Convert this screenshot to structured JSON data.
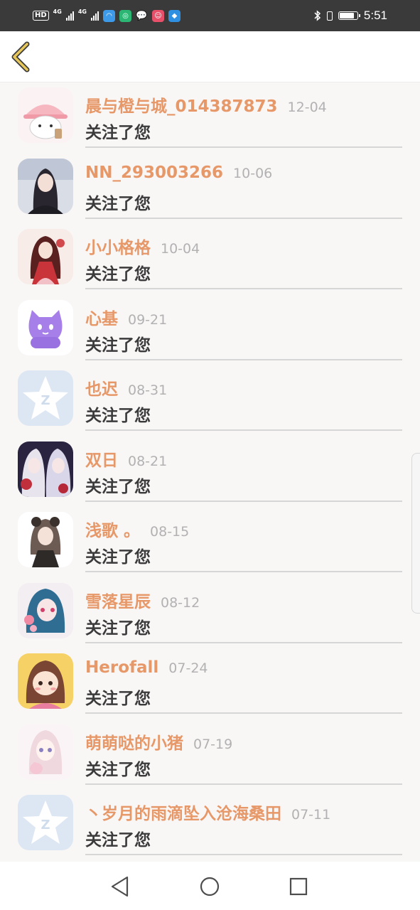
{
  "status_bar": {
    "hd": "HD",
    "network1": "4G",
    "network2": "4G",
    "time": "5:51",
    "battery_level": 0.9,
    "icons": [
      "hd-icon",
      "signal-icon",
      "signal-icon",
      "app-icon",
      "app-icon",
      "wechat-icon",
      "app-icon",
      "app-icon",
      "bluetooth-icon",
      "vibrate-icon",
      "battery-icon"
    ]
  },
  "header": {
    "back_icon": "chevron-left-icon",
    "accent": "#e7c65a"
  },
  "followers": [
    {
      "name": "晨与橙与城_014387873",
      "date": "12-04",
      "action": "关注了您"
    },
    {
      "name": "NN_293003266",
      "date": "10-06",
      "action": "关注了您"
    },
    {
      "name": "小小格格",
      "date": "10-04",
      "action": "关注了您"
    },
    {
      "name": "心基",
      "date": "09-21",
      "action": "关注了您"
    },
    {
      "name": "也迟",
      "date": "08-31",
      "action": "关注了您"
    },
    {
      "name": "双日",
      "date": "08-21",
      "action": "关注了您"
    },
    {
      "name": "浅歌 。",
      "date": "08-15",
      "action": "关注了您"
    },
    {
      "name": "雪落星辰",
      "date": "08-12",
      "action": "关注了您"
    },
    {
      "name": "Herofall",
      "date": "07-24",
      "action": "关注了您"
    },
    {
      "name": "萌萌哒的小猪",
      "date": "07-19",
      "action": "关注了您"
    },
    {
      "name": "丶岁月的雨滴坠入沧海桑田",
      "date": "07-11",
      "action": "关注了您"
    }
  ],
  "colors": {
    "name": "#e79868",
    "date": "#b2b2b2",
    "action": "#3b3b3b",
    "background": "#f9f6f6"
  },
  "nav_bar": {
    "icons": [
      "back-triangle-icon",
      "home-circle-icon",
      "recents-square-icon"
    ]
  }
}
